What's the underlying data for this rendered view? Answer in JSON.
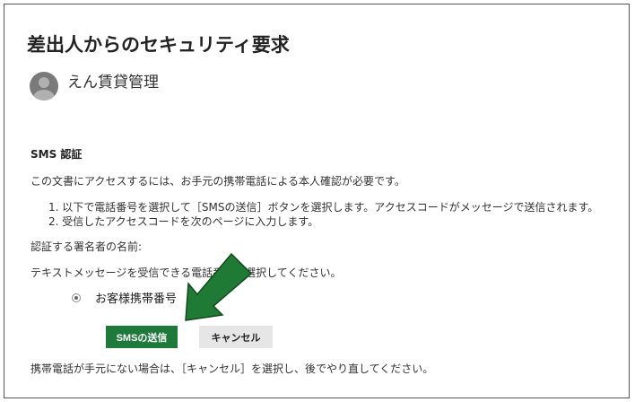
{
  "page": {
    "title": "差出人からのセキュリティ要求",
    "sender_name": "えん賃貸管理"
  },
  "sms": {
    "section_title": "SMS 認証",
    "intro": "この文書にアクセスするには、お手元の携帯電話による本人確認が必要です。",
    "steps": [
      "1. 以下で電話番号を選択して［SMSの送信］ボタンを選択します。アクセスコードがメッセージで送信されます。",
      "2. 受信したアクセスコードを次のページに入力します。"
    ],
    "signer_label": "認証する署名者の名前:",
    "select_prompt": "テキストメッセージを受信できる電話番号を選択してください。",
    "phone_option": "お客様携帯番号",
    "send_button": "SMSの送信",
    "cancel_button": "キャンセル",
    "footer": "携帯電話が手元にない場合は、［キャンセル］を選択し、後でやり直してください。"
  },
  "colors": {
    "send_button_bg": "#1e7a3a",
    "arrow_fill": "#1f7a35",
    "arrow_stroke": "#0f4a1c"
  },
  "icons": {
    "avatar": "user-avatar-icon",
    "annotation": "green-arrow-icon"
  }
}
